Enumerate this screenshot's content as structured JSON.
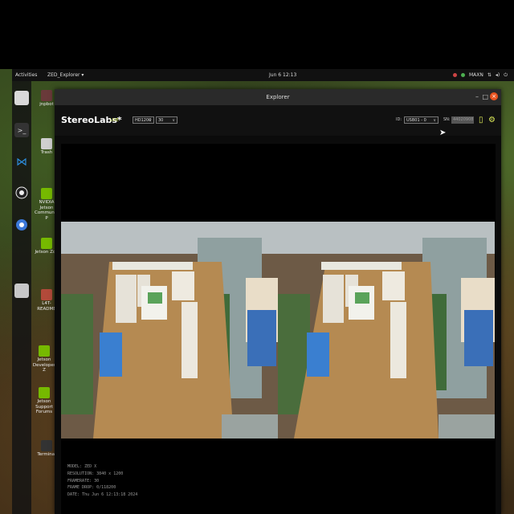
{
  "topbar": {
    "activities": "Activities",
    "app_menu": "ZED_Explorer ▾",
    "clock": "Jun 6  12:13",
    "power_mode": "MAXN",
    "icons": [
      "nvidia-icon",
      "network-icon",
      "volume-icon",
      "power-icon"
    ]
  },
  "dock": {
    "items": [
      "files-icon",
      "terminal-icon",
      "vscode-icon",
      "obs-icon",
      "chromium-icon",
      "drive-icon"
    ]
  },
  "desktop": {
    "icons": [
      {
        "label": "jnpbot",
        "icon": "home-folder-icon"
      },
      {
        "label": "Trash",
        "icon": "trash-icon"
      },
      {
        "label": "NVIDIA Jetson Community P",
        "icon": "nvidia-link-icon"
      },
      {
        "label": "Jetson Zoo",
        "icon": "nvidia-link-icon"
      },
      {
        "label": "L4T-README",
        "icon": "readme-folder-icon"
      },
      {
        "label": "Jetson Developer Z",
        "icon": "nvidia-link-icon"
      },
      {
        "label": "Jetson Support Forums",
        "icon": "nvidia-link-icon"
      },
      {
        "label": "Terminal",
        "icon": "terminal-icon"
      }
    ]
  },
  "window": {
    "title": "Explorer",
    "minimize": "–",
    "maximize": "□",
    "close": "×"
  },
  "toolbar": {
    "brand": "StereoLabs*",
    "live": "LIVE",
    "resolution": "HD1200",
    "fps": "30",
    "id_label": "ID:",
    "camera": "USB01 - 0",
    "sn_label": "SN:",
    "sn_value": "44020908"
  },
  "info": {
    "model": "MODEL: ZED X",
    "resolution": "RESOLUTION: 3840 x 1200",
    "framerate": "FRAMERATE: 30",
    "frame_drop": "FRAME DROP: 0/118200",
    "date": "DATE: Thu Jun 6 12:13:18 2024"
  },
  "colors": {
    "accent": "#e2f05a",
    "close_button": "#e95420",
    "nvidia_green": "#76b900"
  }
}
